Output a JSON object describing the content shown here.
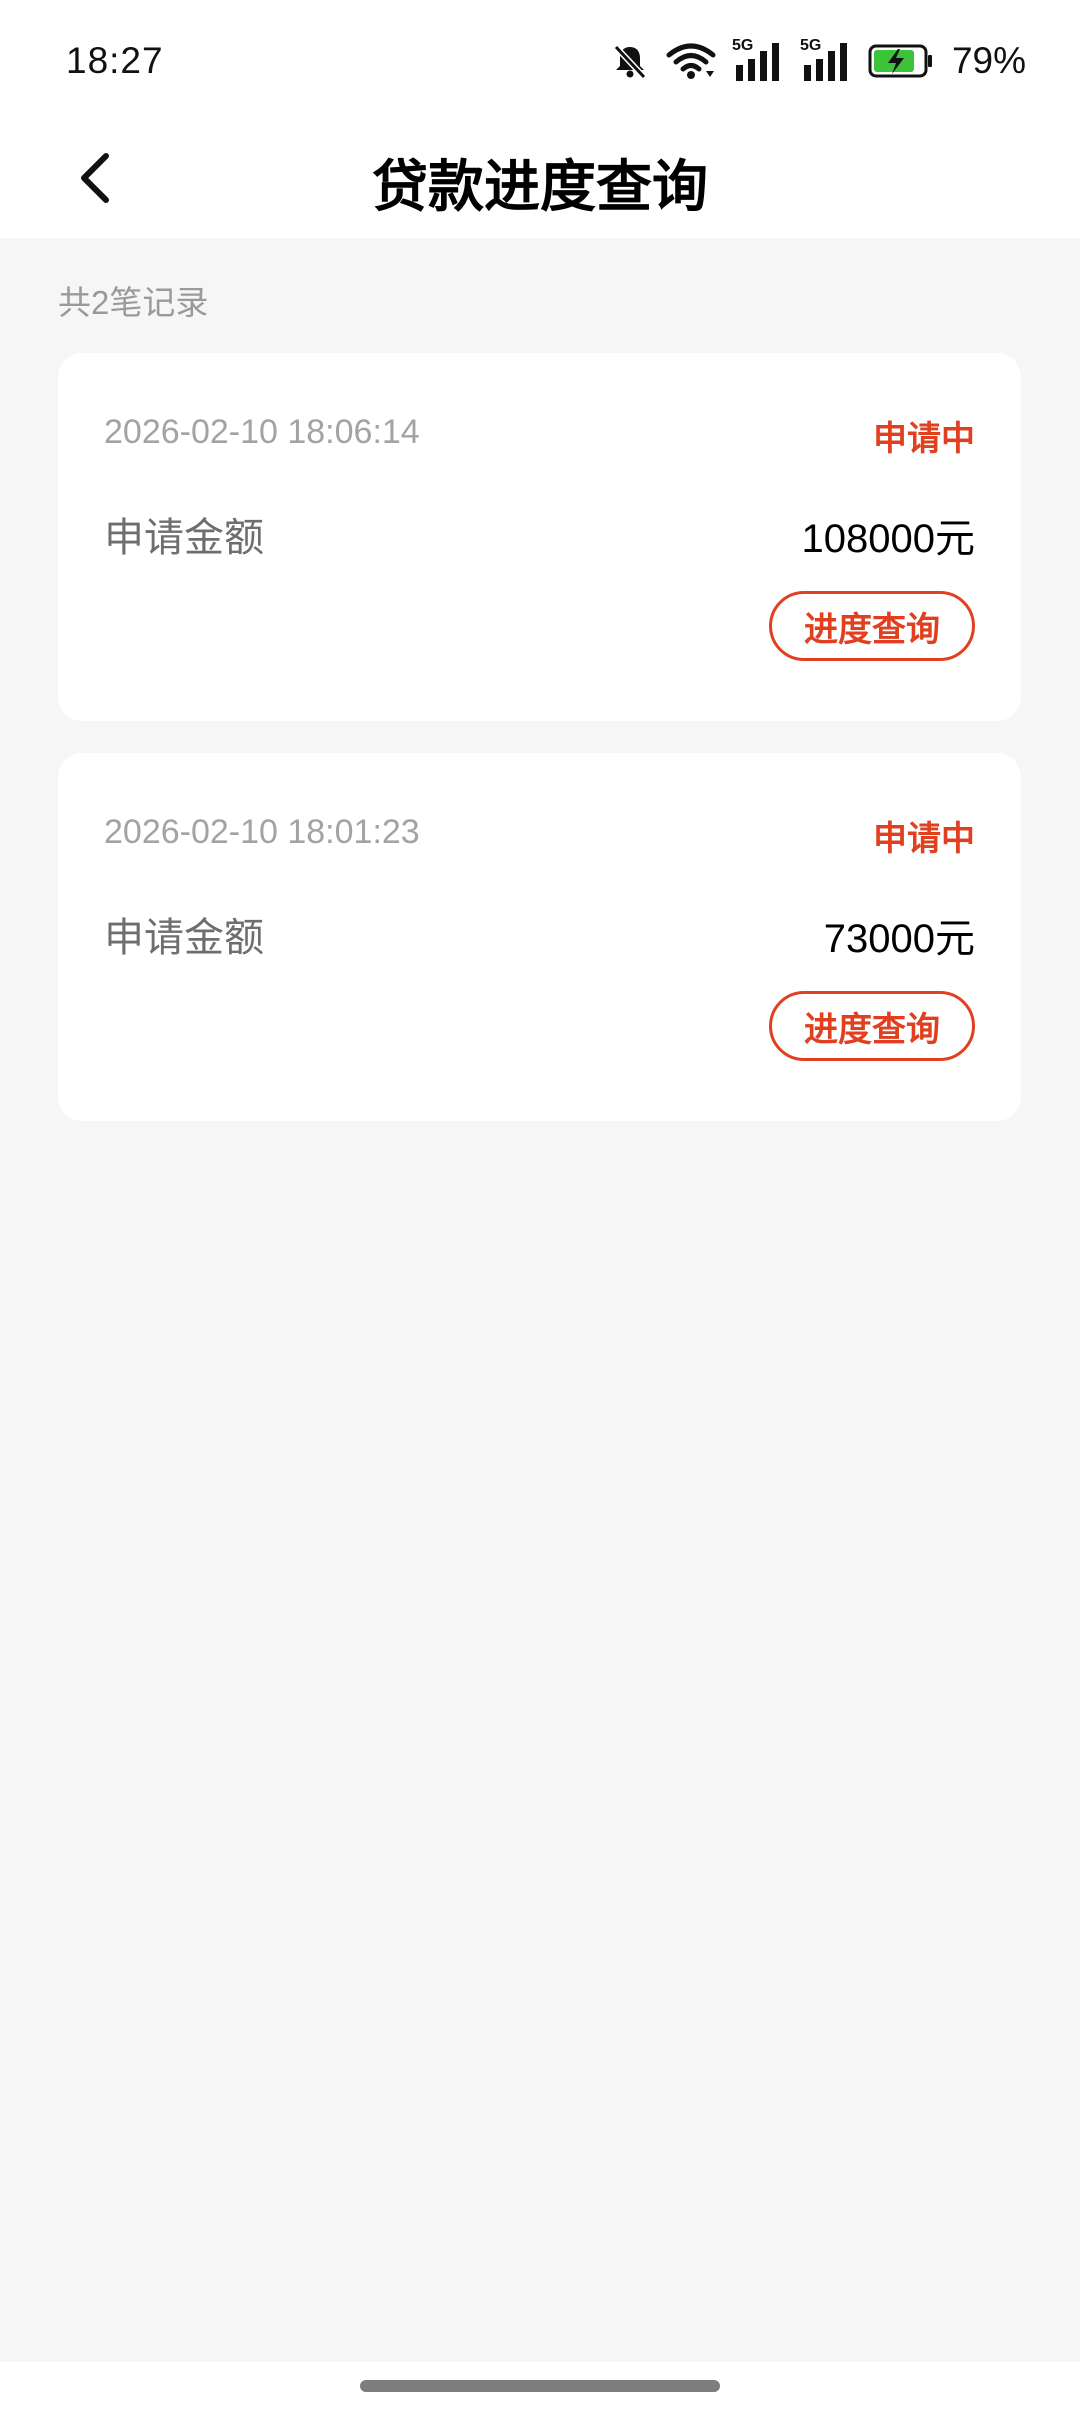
{
  "status_bar": {
    "time": "18:27",
    "signal_label_1": "5G",
    "signal_label_2": "5G",
    "battery_percent": "79%",
    "icons": [
      "bell-muted-icon",
      "wifi-icon",
      "signal-5g-icon",
      "signal-5g-icon",
      "battery-charging-icon"
    ]
  },
  "header": {
    "title": "贷款进度查询",
    "back_icon": "chevron-left-icon"
  },
  "summary": {
    "text": "共2笔记录"
  },
  "records": [
    {
      "time": "2026-02-10 18:06:14",
      "status": "申请中",
      "label": "申请金额",
      "amount": "108000元",
      "button": "进度查询"
    },
    {
      "time": "2026-02-10 18:01:23",
      "status": "申请中",
      "label": "申请金额",
      "amount": "73000元",
      "button": "进度查询"
    }
  ],
  "colors": {
    "accent": "#e0401f",
    "background": "#f6f6f6",
    "card": "#ffffff",
    "battery_fill": "#3cc33a"
  }
}
